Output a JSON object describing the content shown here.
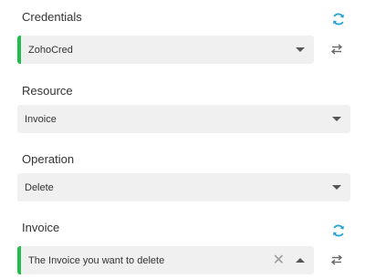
{
  "credentials": {
    "label": "Credentials",
    "value": "ZohoCred"
  },
  "resource": {
    "label": "Resource",
    "value": "Invoice"
  },
  "operation": {
    "label": "Operation",
    "value": "Delete"
  },
  "invoice": {
    "label": "Invoice",
    "value": "The Invoice you want to delete"
  },
  "colors": {
    "accent": "#1fbf4a",
    "refresh_icon": "#29a3d6",
    "field_bg": "#f0f0f0"
  },
  "icons": [
    "refresh-icon",
    "swap-icon",
    "caret-down-icon",
    "caret-up-icon",
    "clear-icon"
  ]
}
